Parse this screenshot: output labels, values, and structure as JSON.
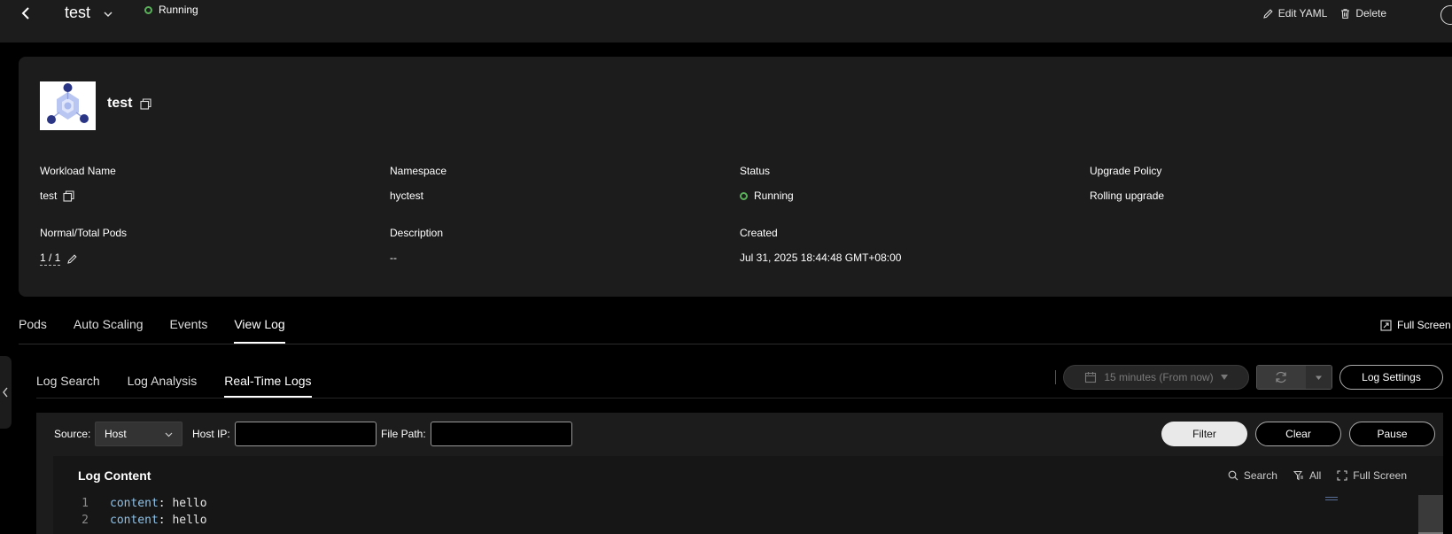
{
  "header": {
    "title": "test",
    "status": "Running",
    "edit_yaml": "Edit YAML",
    "delete": "Delete"
  },
  "card": {
    "name": "test",
    "fields": {
      "workload_name": {
        "label": "Workload Name",
        "value": "test"
      },
      "namespace": {
        "label": "Namespace",
        "value": "hyctest"
      },
      "status": {
        "label": "Status",
        "value": "Running"
      },
      "upgrade_policy": {
        "label": "Upgrade Policy",
        "value": "Rolling upgrade"
      },
      "pods": {
        "label": "Normal/Total Pods",
        "value": "1 / 1"
      },
      "description": {
        "label": "Description",
        "value": "--"
      },
      "created": {
        "label": "Created",
        "value": "Jul 31, 2025 18:44:48 GMT+08:00"
      }
    }
  },
  "tabs": [
    "Pods",
    "Auto Scaling",
    "Events",
    "View Log"
  ],
  "full_screen": "Full Screen",
  "subtabs": [
    "Log Search",
    "Log Analysis",
    "Real-Time Logs"
  ],
  "toolbar": {
    "time_range": "15 minutes (From now)",
    "log_settings": "Log Settings"
  },
  "filter": {
    "source_label": "Source:",
    "source_value": "Host",
    "host_ip_label": "Host IP:",
    "host_ip_value": "",
    "file_path_label": "File Path:",
    "file_path_value": "",
    "filter_btn": "Filter",
    "clear_btn": "Clear",
    "pause_btn": "Pause"
  },
  "log": {
    "title": "Log Content",
    "search": "Search",
    "all": "All",
    "full_screen": "Full Screen",
    "lines": [
      {
        "n": "1",
        "key": "content",
        "value": "hello"
      },
      {
        "n": "2",
        "key": "content",
        "value": "hello"
      }
    ]
  },
  "colors": {
    "running": "#5ab05a",
    "panel": "#1c1c1c",
    "code_key": "#8fc3ea"
  }
}
